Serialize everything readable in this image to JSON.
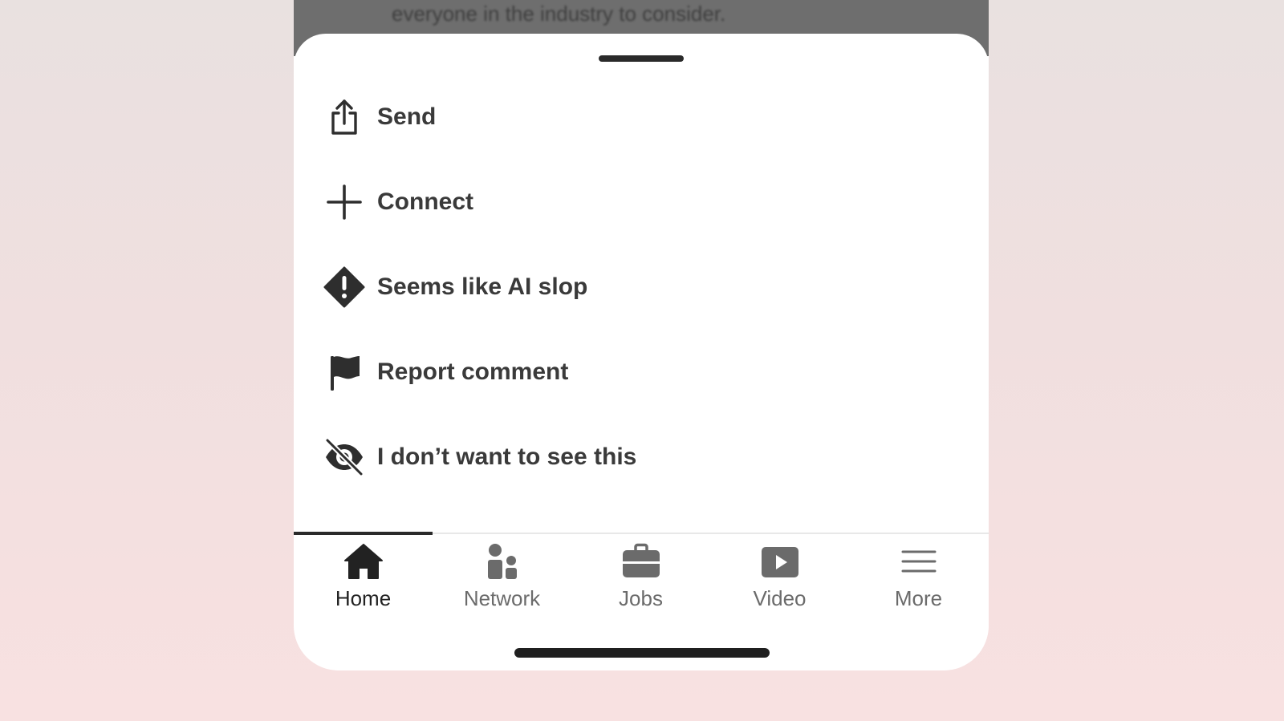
{
  "backdrop": {
    "text": "everyone in the industry to consider."
  },
  "menu": {
    "items": [
      {
        "label": "Send",
        "icon": "share-upload-icon"
      },
      {
        "label": "Connect",
        "icon": "plus-icon"
      },
      {
        "label": "Seems like AI slop",
        "icon": "warning-diamond-icon"
      },
      {
        "label": "Report comment",
        "icon": "flag-icon"
      },
      {
        "label": "I don’t want to see this",
        "icon": "eye-slash-icon"
      }
    ]
  },
  "tabbar": {
    "active": "Home",
    "tabs": [
      {
        "label": "Home",
        "icon": "home-icon"
      },
      {
        "label": "Network",
        "icon": "network-people-icon"
      },
      {
        "label": "Jobs",
        "icon": "briefcase-icon"
      },
      {
        "label": "Video",
        "icon": "video-play-icon"
      },
      {
        "label": "More",
        "icon": "menu-lines-icon"
      }
    ]
  },
  "colors": {
    "text_primary": "#3a3a3a",
    "tab_inactive": "#6b6b6b",
    "tab_active": "#222222",
    "sheet_bg": "#ffffff",
    "page_bg_top": "#e9e1e0",
    "page_bg_bottom": "#f8e1e1"
  }
}
